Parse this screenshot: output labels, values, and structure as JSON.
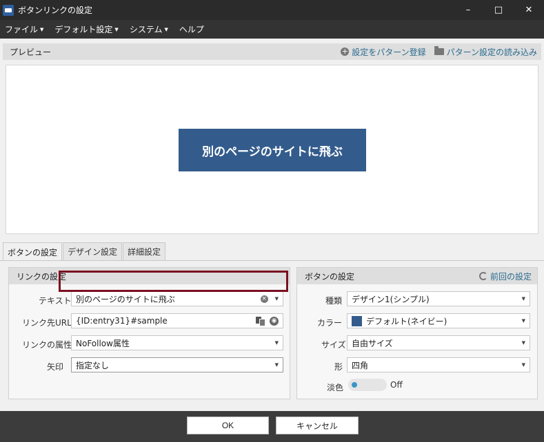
{
  "window": {
    "title": "ボタンリンクの設定",
    "minimize": "–",
    "maximize": "□",
    "close": "✕"
  },
  "menu": {
    "items": [
      {
        "label": "ファイル",
        "dropdown": true
      },
      {
        "label": "デフォルト設定",
        "dropdown": true
      },
      {
        "label": "システム",
        "dropdown": true
      },
      {
        "label": "ヘルプ",
        "dropdown": false
      }
    ]
  },
  "preview": {
    "title": "プレビュー",
    "register_pattern": "設定をパターン登録",
    "load_pattern": "パターン設定の読み込み",
    "button_text": "別のページのサイトに飛ぶ",
    "button_color": "#335c8c"
  },
  "tabs": [
    {
      "label": "ボタンの設定",
      "active": true
    },
    {
      "label": "デザイン設定",
      "active": false
    },
    {
      "label": "詳細設定",
      "active": false
    }
  ],
  "link_settings": {
    "title": "リンクの設定",
    "text_label": "テキスト",
    "text_value": "別のページのサイトに飛ぶ",
    "url_label": "リンク先URL",
    "url_value": "{ID:entry31}#sample",
    "rel_label": "リンクの属性",
    "rel_value": "NoFollow属性",
    "arrow_label": "矢印",
    "arrow_value": "指定なし"
  },
  "button_settings": {
    "title": "ボタンの設定",
    "previous_settings": "前回の設定",
    "type_label": "種類",
    "type_value": "デザイン1(シンプル)",
    "color_label": "カラー",
    "color_value": "デフォルト(ネイビー)",
    "color_swatch": "#335c8c",
    "size_label": "サイズ",
    "size_value": "自由サイズ",
    "shape_label": "形",
    "shape_value": "四角",
    "pale_label": "淡色",
    "pale_value": "Off"
  },
  "footer": {
    "ok": "OK",
    "cancel": "キャンセル"
  },
  "colors": {
    "accent_link": "#2a6b8e",
    "highlight_border": "#7a1020",
    "toggle_knob": "#3a94c8"
  }
}
